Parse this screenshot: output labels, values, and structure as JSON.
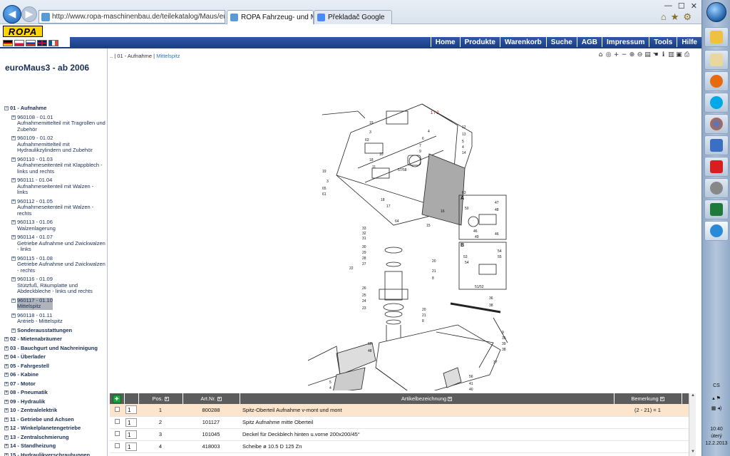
{
  "browser": {
    "url": "http://www.ropa-maschinenbau.de/teilekatalog/Maus/euroMa",
    "tabs": [
      {
        "label": "ROPA Fahrzeug- und Masc..."
      },
      {
        "label": "Překladač Google"
      }
    ]
  },
  "site": {
    "logo": "ROPA",
    "menu": [
      "Home",
      "Produkte",
      "Warenkorb",
      "Suche",
      "AGB",
      "Impressum",
      "Tools",
      "Hilfe"
    ],
    "colors": {
      "menu": "#1c3f86",
      "logo": "#ffd400",
      "highlight_row": "#fde4cc"
    }
  },
  "sidebar": {
    "title": "euroMaus3 - ab 2006",
    "section_open": {
      "label": "01 - Aufnahme"
    },
    "items": [
      {
        "code": "960108 - 01.01",
        "label": "Aufnahmemittelteil mit Tragrollen und Zubehör"
      },
      {
        "code": "960109 - 01.02",
        "label": "Aufnahmemittelteil mit Hydraulikzylindern und Zubehör"
      },
      {
        "code": "960110 - 01.03",
        "label": "Aufnahmeseitenteil mit Klappblech - links und rechts"
      },
      {
        "code": "960111 - 01.04",
        "label": "Aufnahmeseitenteil mit Walzen - links"
      },
      {
        "code": "960112 - 01.05",
        "label": "Aufnahmeseitenteil mit Walzen - rechts"
      },
      {
        "code": "960113 - 01.06",
        "label": "Walzenlagerung"
      },
      {
        "code": "960114 - 01.07",
        "label": "Getriebe Aufnahme und Zwickwalzen - links"
      },
      {
        "code": "960115 - 01.08",
        "label": "Getriebe Aufnahme und Zwickwalzen - rechts"
      },
      {
        "code": "960116 - 01.09",
        "label": "Stützfuß, Räumplatte und Abdeckbleche - links und rechts"
      },
      {
        "code": "960117 - 01.10",
        "label": "Mittelspitz"
      },
      {
        "code": "960118 - 01.11",
        "label": "Antrieb - Mittelspitz"
      },
      {
        "code": "",
        "label": "Sonderausstattungen"
      }
    ],
    "sections": [
      "02 - Mietenabräumer",
      "03 - Bauchgurt und Nachreinigung",
      "04 - Überlader",
      "05 - Fahrgestell",
      "06 - Kabine",
      "07 - Motor",
      "08 - Pneumatik",
      "09 - Hydraulik",
      "10 - Zentralelektrik",
      "11 - Getriebe und Achsen",
      "12 - Winkelplanetengetriebe",
      "13 - Zentralschmierung",
      "14 - Standheizung",
      "15 - Hydraulikverschraubungen"
    ]
  },
  "breadcrumb": {
    "prefix": "..",
    "parent": "01 - Aufnahme",
    "current": "Mittelspitz"
  },
  "diagram": {
    "page": "1 / 2",
    "callouts": [
      "19",
      "3",
      "63",
      "2",
      "12",
      "13",
      "5",
      "4",
      "14",
      "4",
      "6",
      "7",
      "9",
      "10",
      "18",
      "11",
      "57/58",
      "19",
      "3",
      "65",
      "61",
      "18",
      "17",
      "63",
      "64",
      "16",
      "15",
      "33",
      "32",
      "31",
      "30",
      "29",
      "28",
      "27",
      "26",
      "22",
      "25",
      "24",
      "23",
      "20",
      "21",
      "8",
      "20",
      "21",
      "8",
      "36",
      "38",
      "60",
      "48",
      "9",
      "35",
      "39",
      "38",
      "37",
      "5",
      "4",
      "43",
      "42",
      "34/66",
      "1",
      "56",
      "41",
      "40",
      "44",
      "47",
      "50",
      "48",
      "46",
      "49",
      "53",
      "54",
      "55",
      "51/52",
      "A",
      "B"
    ],
    "detail_labels": [
      "A",
      "B"
    ]
  },
  "table": {
    "headers": [
      "Pos.",
      "Art.Nr.",
      "Artikelbezeichnung",
      "Bemerkung"
    ],
    "rows": [
      {
        "qty": "1",
        "pos": "1",
        "art": "800288",
        "desc": "Spitz-Oberteil Aufnahme v-mont und mont",
        "note": "(2 - 21) = 1"
      },
      {
        "qty": "1",
        "pos": "2",
        "art": "101127",
        "desc": "Spitz Aufnahme mitte Oberteil",
        "note": ""
      },
      {
        "qty": "1",
        "pos": "3",
        "art": "101045",
        "desc": "Deckel für Deckblech hinten u.vorne 200x200/45°",
        "note": ""
      },
      {
        "qty": "1",
        "pos": "4",
        "art": "418003",
        "desc": "Scheibe ø 10.5 D 125 Zn",
        "note": ""
      }
    ]
  },
  "taskbar": {
    "lang": "CS",
    "time": "10:40",
    "day": "úterý",
    "date": "12.2.2013"
  }
}
